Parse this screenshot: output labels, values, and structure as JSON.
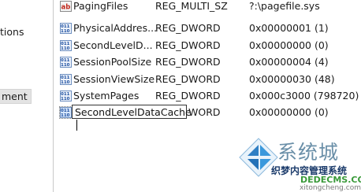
{
  "tree": {
    "items": [
      {
        "label": "tions"
      },
      {
        "label": "ment"
      }
    ]
  },
  "values": {
    "rows": [
      {
        "name": "PagingFiles",
        "type": "REG_MULTI_SZ",
        "data": "?:\\pagefile.sys",
        "icon": "string-value-icon"
      },
      {
        "name": "PhysicalAddres...",
        "type": "REG_DWORD",
        "data": "0x00000001 (1)",
        "icon": "binary-value-icon"
      },
      {
        "name": "SecondLevelD...",
        "type": "REG_DWORD",
        "data": "0x00000000 (0)",
        "icon": "binary-value-icon"
      },
      {
        "name": "SessionPoolSize",
        "type": "REG_DWORD",
        "data": "0x00000004 (4)",
        "icon": "binary-value-icon"
      },
      {
        "name": "SessionViewSize",
        "type": "REG_DWORD",
        "data": "0x00000030 (48)",
        "icon": "binary-value-icon"
      },
      {
        "name": "SystemPages",
        "type": "REG_DWORD",
        "data": "0x000c3000 (798720)",
        "icon": "binary-value-icon"
      }
    ],
    "editing": {
      "value": "SecondLevelDataCache",
      "type_tail": "WORD",
      "data": "0x00000000 (0)",
      "icon": "binary-value-icon"
    }
  },
  "watermark": {
    "title": "系统城",
    "subtitle": "织梦内容管理系统",
    "domain": "DEDECMS.COM",
    "url": "xitongcheng.com"
  }
}
